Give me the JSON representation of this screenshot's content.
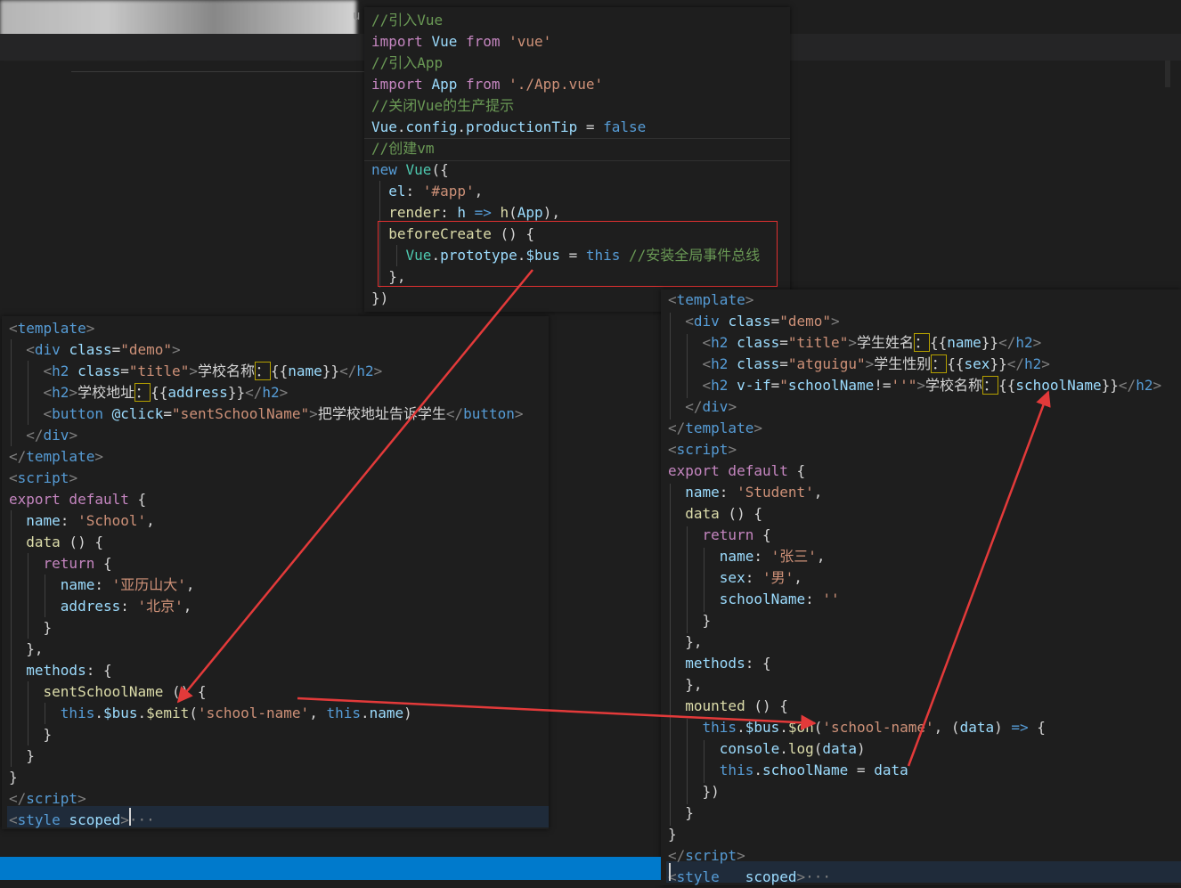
{
  "background": {
    "tab_fragment": "u"
  },
  "main_js": {
    "lines": [
      [
        [
          "c-com",
          "//引入Vue"
        ]
      ],
      [
        [
          "c-kw",
          "import "
        ],
        [
          "c-id",
          "Vue "
        ],
        [
          "c-kw",
          "from "
        ],
        [
          "c-str",
          "'vue'"
        ]
      ],
      [
        [
          "c-com",
          "//引入App"
        ]
      ],
      [
        [
          "c-kw",
          "import "
        ],
        [
          "c-id",
          "App "
        ],
        [
          "c-kw",
          "from "
        ],
        [
          "c-str",
          "'./App.vue'"
        ]
      ],
      [
        [
          "c-com",
          "//关闭Vue的生产提示"
        ]
      ],
      [
        [
          "c-id",
          "Vue"
        ],
        [
          "c-pun",
          "."
        ],
        [
          "c-id",
          "config"
        ],
        [
          "c-pun",
          "."
        ],
        [
          "c-id",
          "productionTip"
        ],
        [
          "c-pun",
          " = "
        ],
        [
          "c-kwb",
          "false"
        ]
      ],
      [
        [
          "c-com",
          "//创建vm"
        ]
      ],
      [
        [
          "c-kwb",
          "new "
        ],
        [
          "c-cls",
          "Vue"
        ],
        [
          "c-pun",
          "({"
        ]
      ],
      [
        [
          "c-pun",
          "  "
        ],
        [
          "c-id",
          "el"
        ],
        [
          "c-pun",
          ": "
        ],
        [
          "c-str",
          "'#app'"
        ],
        [
          "c-pun",
          ","
        ]
      ],
      [
        [
          "c-pun",
          "  "
        ],
        [
          "c-fn",
          "render"
        ],
        [
          "c-pun",
          ": "
        ],
        [
          "c-id",
          "h"
        ],
        [
          "c-kwb",
          " => "
        ],
        [
          "c-fn",
          "h"
        ],
        [
          "c-pun",
          "("
        ],
        [
          "c-id",
          "App"
        ],
        [
          "c-pun",
          "),"
        ]
      ],
      [
        [
          "c-pun",
          "  "
        ],
        [
          "c-fn",
          "beforeCreate"
        ],
        [
          "c-pun",
          " () {"
        ]
      ],
      [
        [
          "c-pun",
          "    "
        ],
        [
          "c-cls",
          "Vue"
        ],
        [
          "c-pun",
          "."
        ],
        [
          "c-id",
          "prototype"
        ],
        [
          "c-pun",
          "."
        ],
        [
          "c-id",
          "$bus"
        ],
        [
          "c-pun",
          " = "
        ],
        [
          "c-kwb",
          "this "
        ],
        [
          "c-com",
          "//安装全局事件总线"
        ]
      ],
      [
        [
          "c-pun",
          "  },"
        ]
      ],
      [
        [
          "c-pun",
          "})"
        ]
      ]
    ]
  },
  "school_vue": {
    "lines": [
      [
        [
          "c-br",
          "<"
        ],
        [
          "c-tag",
          "template"
        ],
        [
          "c-br",
          ">"
        ]
      ],
      [
        [
          "c-pun",
          "  "
        ],
        [
          "c-br",
          "<"
        ],
        [
          "c-tag",
          "div "
        ],
        [
          "c-attr",
          "class"
        ],
        [
          "c-pun",
          "="
        ],
        [
          "c-str",
          "\"demo\""
        ],
        [
          "c-br",
          ">"
        ]
      ],
      [
        [
          "c-pun",
          "    "
        ],
        [
          "c-br",
          "<"
        ],
        [
          "c-tag",
          "h2 "
        ],
        [
          "c-attr",
          "class"
        ],
        [
          "c-pun",
          "="
        ],
        [
          "c-str",
          "\"title\""
        ],
        [
          "c-br",
          ">"
        ],
        [
          "c-txt",
          "学校名称"
        ],
        [
          "c-txt mark",
          "："
        ],
        [
          "c-mus",
          "{{"
        ],
        [
          "c-id",
          "name"
        ],
        [
          "c-mus",
          "}}"
        ],
        [
          "c-br",
          "</"
        ],
        [
          "c-tag",
          "h2"
        ],
        [
          "c-br",
          ">"
        ]
      ],
      [
        [
          "c-pun",
          "    "
        ],
        [
          "c-br",
          "<"
        ],
        [
          "c-tag",
          "h2"
        ],
        [
          "c-br",
          ">"
        ],
        [
          "c-txt",
          "学校地址"
        ],
        [
          "c-txt mark",
          "："
        ],
        [
          "c-mus",
          "{{"
        ],
        [
          "c-id",
          "address"
        ],
        [
          "c-mus",
          "}}"
        ],
        [
          "c-br",
          "</"
        ],
        [
          "c-tag",
          "h2"
        ],
        [
          "c-br",
          ">"
        ]
      ],
      [
        [
          "c-pun",
          "    "
        ],
        [
          "c-br",
          "<"
        ],
        [
          "c-tag",
          "button "
        ],
        [
          "c-attr",
          "@click"
        ],
        [
          "c-pun",
          "="
        ],
        [
          "c-str",
          "\"sentSchoolName\""
        ],
        [
          "c-br",
          ">"
        ],
        [
          "c-txt",
          "把学校地址告诉学生"
        ],
        [
          "c-br",
          "</"
        ],
        [
          "c-tag",
          "button"
        ],
        [
          "c-br",
          ">"
        ]
      ],
      [
        [
          "c-pun",
          "  "
        ],
        [
          "c-br",
          "</"
        ],
        [
          "c-tag",
          "div"
        ],
        [
          "c-br",
          ">"
        ]
      ],
      [
        [
          "c-br",
          "</"
        ],
        [
          "c-tag",
          "template"
        ],
        [
          "c-br",
          ">"
        ]
      ],
      [
        [
          "c-br",
          "<"
        ],
        [
          "c-tag",
          "script"
        ],
        [
          "c-br",
          ">"
        ]
      ],
      [
        [
          "c-kw",
          "export default "
        ],
        [
          "c-pun",
          "{"
        ]
      ],
      [
        [
          "c-pun",
          "  "
        ],
        [
          "c-id",
          "name"
        ],
        [
          "c-pun",
          ": "
        ],
        [
          "c-str",
          "'School'"
        ],
        [
          "c-pun",
          ","
        ]
      ],
      [
        [
          "c-pun",
          "  "
        ],
        [
          "c-fn",
          "data"
        ],
        [
          "c-pun",
          " () {"
        ]
      ],
      [
        [
          "c-pun",
          "    "
        ],
        [
          "c-kw",
          "return "
        ],
        [
          "c-pun",
          "{"
        ]
      ],
      [
        [
          "c-pun",
          "      "
        ],
        [
          "c-id",
          "name"
        ],
        [
          "c-pun",
          ": "
        ],
        [
          "c-str",
          "'亚历山大'"
        ],
        [
          "c-pun",
          ","
        ]
      ],
      [
        [
          "c-pun",
          "      "
        ],
        [
          "c-id",
          "address"
        ],
        [
          "c-pun",
          ": "
        ],
        [
          "c-str",
          "'北京'"
        ],
        [
          "c-pun",
          ","
        ]
      ],
      [
        [
          "c-pun",
          "    }"
        ]
      ],
      [
        [
          "c-pun",
          "  },"
        ]
      ],
      [
        [
          "c-pun",
          "  "
        ],
        [
          "c-id",
          "methods"
        ],
        [
          "c-pun",
          ": {"
        ]
      ],
      [
        [
          "c-pun",
          "    "
        ],
        [
          "c-fn",
          "sentSchoolName"
        ],
        [
          "c-pun",
          " () {"
        ]
      ],
      [
        [
          "c-pun",
          "      "
        ],
        [
          "c-kwb",
          "this"
        ],
        [
          "c-pun",
          "."
        ],
        [
          "c-id",
          "$bus"
        ],
        [
          "c-pun",
          "."
        ],
        [
          "c-fn",
          "$emit"
        ],
        [
          "c-pun",
          "("
        ],
        [
          "c-str",
          "'school-name'"
        ],
        [
          "c-pun",
          ", "
        ],
        [
          "c-kwb",
          "this"
        ],
        [
          "c-pun",
          "."
        ],
        [
          "c-id",
          "name"
        ],
        [
          "c-pun",
          ")"
        ]
      ],
      [
        [
          "c-pun",
          "    }"
        ]
      ],
      [
        [
          "c-pun",
          "  }"
        ]
      ],
      [
        [
          "c-pun",
          "}"
        ]
      ],
      [
        [
          "c-br",
          "</"
        ],
        [
          "c-tag",
          "script"
        ],
        [
          "c-br",
          ">"
        ]
      ],
      [
        [
          "c-br",
          "<"
        ],
        [
          "c-tag",
          "style "
        ],
        [
          "c-attr",
          "scoped"
        ],
        [
          "c-br",
          ">"
        ],
        [
          "c-br",
          "···"
        ]
      ]
    ]
  },
  "student_vue": {
    "lines": [
      [
        [
          "c-br",
          "<"
        ],
        [
          "c-tag",
          "template"
        ],
        [
          "c-br",
          ">"
        ]
      ],
      [
        [
          "c-pun",
          "  "
        ],
        [
          "c-br",
          "<"
        ],
        [
          "c-tag",
          "div "
        ],
        [
          "c-attr",
          "class"
        ],
        [
          "c-pun",
          "="
        ],
        [
          "c-str",
          "\"demo\""
        ],
        [
          "c-br",
          ">"
        ]
      ],
      [
        [
          "c-pun",
          "    "
        ],
        [
          "c-br",
          "<"
        ],
        [
          "c-tag",
          "h2 "
        ],
        [
          "c-attr",
          "class"
        ],
        [
          "c-pun",
          "="
        ],
        [
          "c-str",
          "\"title\""
        ],
        [
          "c-br",
          ">"
        ],
        [
          "c-txt",
          "学生姓名"
        ],
        [
          "c-txt mark",
          "："
        ],
        [
          "c-mus",
          "{{"
        ],
        [
          "c-id",
          "name"
        ],
        [
          "c-mus",
          "}}"
        ],
        [
          "c-br",
          "</"
        ],
        [
          "c-tag",
          "h2"
        ],
        [
          "c-br",
          ">"
        ]
      ],
      [
        [
          "c-pun",
          "    "
        ],
        [
          "c-br",
          "<"
        ],
        [
          "c-tag",
          "h2 "
        ],
        [
          "c-attr",
          "class"
        ],
        [
          "c-pun",
          "="
        ],
        [
          "c-str",
          "\"atguigu\""
        ],
        [
          "c-br",
          ">"
        ],
        [
          "c-txt",
          "学生性别"
        ],
        [
          "c-txt mark",
          "："
        ],
        [
          "c-mus",
          "{{"
        ],
        [
          "c-id",
          "sex"
        ],
        [
          "c-mus",
          "}}"
        ],
        [
          "c-br",
          "</"
        ],
        [
          "c-tag",
          "h2"
        ],
        [
          "c-br",
          ">"
        ]
      ],
      [
        [
          "c-pun",
          "    "
        ],
        [
          "c-br",
          "<"
        ],
        [
          "c-tag",
          "h2 "
        ],
        [
          "c-attr",
          "v-if"
        ],
        [
          "c-pun",
          "="
        ],
        [
          "c-str",
          "\""
        ],
        [
          "c-id",
          "schoolName"
        ],
        [
          "c-pun",
          "!="
        ],
        [
          "c-str",
          "''\""
        ],
        [
          "c-br",
          ">"
        ],
        [
          "c-txt",
          "学校名称"
        ],
        [
          "c-txt mark",
          "："
        ],
        [
          "c-mus",
          "{{"
        ],
        [
          "c-id",
          "schoolName"
        ],
        [
          "c-mus",
          "}}"
        ],
        [
          "c-br",
          "</"
        ],
        [
          "c-tag",
          "h2"
        ],
        [
          "c-br",
          ">"
        ]
      ],
      [
        [
          "c-pun",
          "  "
        ],
        [
          "c-br",
          "</"
        ],
        [
          "c-tag",
          "div"
        ],
        [
          "c-br",
          ">"
        ]
      ],
      [
        [
          "c-br",
          "</"
        ],
        [
          "c-tag",
          "template"
        ],
        [
          "c-br",
          ">"
        ]
      ],
      [
        [
          "c-br",
          "<"
        ],
        [
          "c-tag",
          "script"
        ],
        [
          "c-br",
          ">"
        ]
      ],
      [
        [
          "c-kw",
          "export default "
        ],
        [
          "c-pun",
          "{"
        ]
      ],
      [
        [
          "c-pun",
          "  "
        ],
        [
          "c-id",
          "name"
        ],
        [
          "c-pun",
          ": "
        ],
        [
          "c-str",
          "'Student'"
        ],
        [
          "c-pun",
          ","
        ]
      ],
      [
        [
          "c-pun",
          "  "
        ],
        [
          "c-fn",
          "data"
        ],
        [
          "c-pun",
          " () {"
        ]
      ],
      [
        [
          "c-pun",
          "    "
        ],
        [
          "c-kw",
          "return "
        ],
        [
          "c-pun",
          "{"
        ]
      ],
      [
        [
          "c-pun",
          "      "
        ],
        [
          "c-id",
          "name"
        ],
        [
          "c-pun",
          ": "
        ],
        [
          "c-str",
          "'张三'"
        ],
        [
          "c-pun",
          ","
        ]
      ],
      [
        [
          "c-pun",
          "      "
        ],
        [
          "c-id",
          "sex"
        ],
        [
          "c-pun",
          ": "
        ],
        [
          "c-str",
          "'男'"
        ],
        [
          "c-pun",
          ","
        ]
      ],
      [
        [
          "c-pun",
          "      "
        ],
        [
          "c-id",
          "schoolName"
        ],
        [
          "c-pun",
          ": "
        ],
        [
          "c-str",
          "''"
        ]
      ],
      [
        [
          "c-pun",
          "    }"
        ]
      ],
      [
        [
          "c-pun",
          "  },"
        ]
      ],
      [
        [
          "c-pun",
          "  "
        ],
        [
          "c-id",
          "methods"
        ],
        [
          "c-pun",
          ": {"
        ]
      ],
      [
        [
          "c-pun",
          "  },"
        ]
      ],
      [
        [
          "c-pun",
          "  "
        ],
        [
          "c-fn",
          "mounted"
        ],
        [
          "c-pun",
          " () {"
        ]
      ],
      [
        [
          "c-pun",
          "    "
        ],
        [
          "c-kwb",
          "this"
        ],
        [
          "c-pun",
          "."
        ],
        [
          "c-id",
          "$bus"
        ],
        [
          "c-pun",
          "."
        ],
        [
          "c-fn",
          "$on"
        ],
        [
          "c-pun",
          "("
        ],
        [
          "c-str",
          "'school-name'"
        ],
        [
          "c-pun",
          ", ("
        ],
        [
          "c-id",
          "data"
        ],
        [
          "c-pun",
          ") "
        ],
        [
          "c-kwb",
          "=> "
        ],
        [
          "c-pun",
          "{"
        ]
      ],
      [
        [
          "c-pun",
          "      "
        ],
        [
          "c-id",
          "console"
        ],
        [
          "c-pun",
          "."
        ],
        [
          "c-fn",
          "log"
        ],
        [
          "c-pun",
          "("
        ],
        [
          "c-id",
          "data"
        ],
        [
          "c-pun",
          ")"
        ]
      ],
      [
        [
          "c-pun",
          "      "
        ],
        [
          "c-kwb",
          "this"
        ],
        [
          "c-pun",
          "."
        ],
        [
          "c-id",
          "schoolName"
        ],
        [
          "c-pun",
          " = "
        ],
        [
          "c-id",
          "data"
        ]
      ],
      [
        [
          "c-pun",
          "    })"
        ]
      ],
      [
        [
          "c-pun",
          "  }"
        ]
      ],
      [
        [
          "c-pun",
          "}"
        ]
      ],
      [
        [
          "c-br",
          "</"
        ],
        [
          "c-tag",
          "script"
        ],
        [
          "c-br",
          ">"
        ]
      ],
      [
        [
          "c-br",
          "<"
        ],
        [
          "c-tag",
          "style "
        ],
        [
          "c-attr",
          "  scoped"
        ],
        [
          "c-br",
          ">"
        ],
        [
          "c-br",
          "···"
        ]
      ]
    ]
  }
}
